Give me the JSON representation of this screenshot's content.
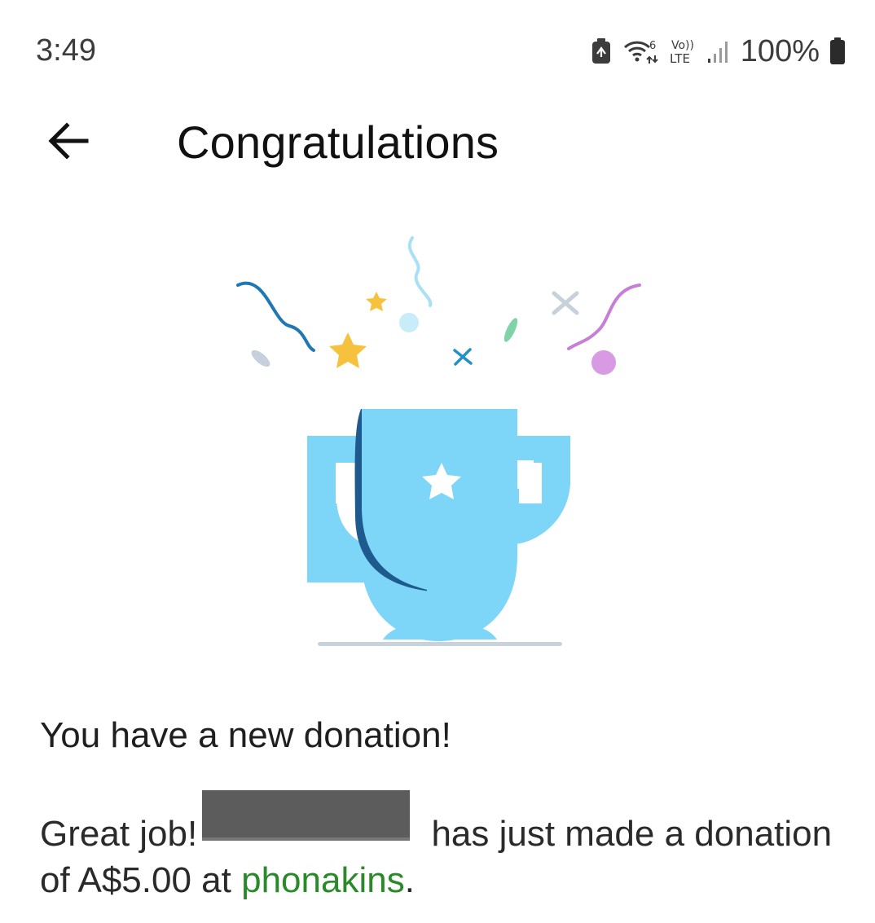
{
  "status_bar": {
    "time": "3:49",
    "battery_percent": "100%",
    "network_label": "LTE",
    "volte_label": "Vo))",
    "wifi_badge": "6"
  },
  "app_bar": {
    "title": "Congratulations"
  },
  "content": {
    "headline": "You have a new donation!",
    "body_prefix": "Great job!",
    "body_middle": " has just made a donation of A$5.00 at ",
    "store_name": "phonakins",
    "body_suffix": "."
  },
  "colors": {
    "trophy_light": "#7dd6f7",
    "trophy_dark": "#1f5a8e",
    "link_green": "#2a8a2a",
    "redaction_gray": "#5c5c5c"
  },
  "icons": [
    "back-arrow-icon",
    "trophy-icon",
    "battery-saver-icon",
    "wifi-icon",
    "signal-icon",
    "battery-icon"
  ]
}
